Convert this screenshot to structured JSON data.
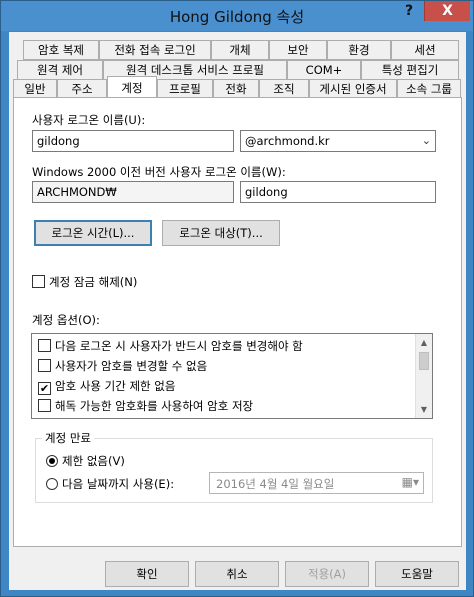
{
  "window": {
    "title": "Hong Gildong 속성",
    "help_label": "?",
    "close_label": "X"
  },
  "tabs": {
    "row1": [
      "암호 복제",
      "전화 접속 로그인",
      "개체",
      "보안",
      "환경",
      "세션"
    ],
    "row2": [
      "원격 제어",
      "원격 데스크톱 서비스 프로필",
      "COM+",
      "특성 편집기"
    ],
    "row3": [
      "일반",
      "주소",
      "계정",
      "프로필",
      "전화",
      "조직",
      "게시된 인증서",
      "소속 그룹"
    ],
    "active": "계정"
  },
  "account": {
    "logon_name_label": "사용자 로그온 이름(U):",
    "logon_name_value": "gildong",
    "domain_suffix": "@archmond.kr",
    "pre2000_label": "Windows 2000 이전 버전 사용자 로그온 이름(W):",
    "pre2000_domain": "ARCHMOND₩",
    "pre2000_name": "gildong",
    "logon_hours_button": "로그온 시간(L)...",
    "logon_to_button": "로그온 대상(T)...",
    "unlock_label": "계정 잠금 해제(N)",
    "unlock_checked": false,
    "options_label": "계정 옵션(O):",
    "options": [
      {
        "label": "다음 로그온 시 사용자가 반드시 암호를 변경해야 함",
        "checked": false
      },
      {
        "label": "사용자가 암호를 변경할 수 없음",
        "checked": false
      },
      {
        "label": "암호 사용 기간 제한 없음",
        "checked": true
      },
      {
        "label": "해독 가능한 암호화를 사용하여 암호 저장",
        "checked": false
      }
    ],
    "expires": {
      "group_title": "계정 만료",
      "never_label": "제한 없음(V)",
      "end_of_label": "다음 날짜까지 사용(E):",
      "selected": "never",
      "date_value": "2016년   4월   4일 월요일"
    }
  },
  "footer": {
    "ok": "확인",
    "cancel": "취소",
    "apply": "적용(A)",
    "help": "도움말"
  },
  "icons": {
    "combo": "chevron-down-icon",
    "calendar": "calendar-icon",
    "check": "checkmark-icon"
  }
}
